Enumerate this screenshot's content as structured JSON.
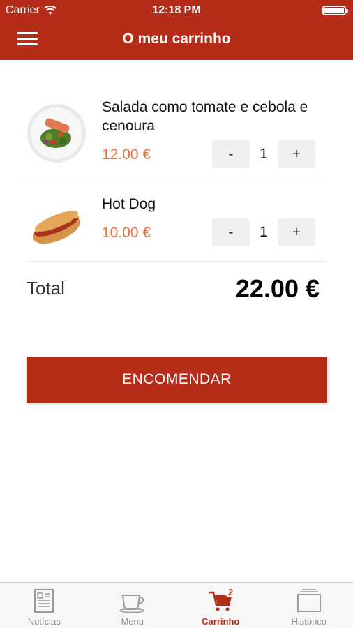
{
  "status_bar": {
    "carrier": "Carrier",
    "time": "12:18 PM"
  },
  "header": {
    "title": "O meu carrinho",
    "menu_icon": "hamburger-icon"
  },
  "cart": {
    "items": [
      {
        "name": "Salada como tomate e cebola e cenoura",
        "price": "12.00 €",
        "quantity": "1",
        "minus": "-",
        "plus": "+",
        "image": "salad-plate-image"
      },
      {
        "name": "Hot Dog",
        "price": "10.00 €",
        "quantity": "1",
        "minus": "-",
        "plus": "+",
        "image": "hot-dog-image"
      }
    ],
    "total_label": "Total",
    "total_value": "22.00 €",
    "order_button": "ENCOMENDAR"
  },
  "tabbar": {
    "tabs": [
      {
        "label": "Notícias",
        "icon": "newspaper-icon"
      },
      {
        "label": "Menu",
        "icon": "coffee-cup-icon"
      },
      {
        "label": "Carrinho",
        "icon": "cart-icon",
        "badge": "2",
        "active": true
      },
      {
        "label": "Histórico",
        "icon": "history-box-icon"
      }
    ]
  },
  "colors": {
    "brand": "#b52d18",
    "price": "#e8733b",
    "tab_inactive": "#8e8e8e"
  }
}
